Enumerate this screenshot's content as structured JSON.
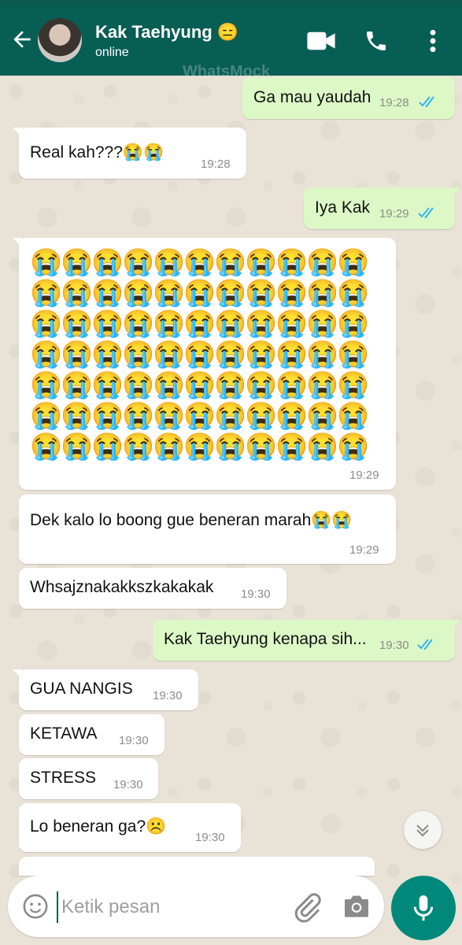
{
  "header": {
    "contact_name": "Kak Taehyung",
    "contact_emoji": "😑",
    "status": "online",
    "watermark": "WhatsMock"
  },
  "messages": [
    {
      "type": "out",
      "text": "Ga mau yaudah",
      "time": "19:28",
      "read": true
    },
    {
      "type": "in",
      "text": "Real kah???😭😭",
      "time": "19:28"
    },
    {
      "type": "out",
      "text": "Iya Kak",
      "time": "19:29",
      "read": true
    },
    {
      "type": "in",
      "emoji_block": "😭",
      "emoji_rows": 7,
      "emoji_cols": 11,
      "time": "19:29"
    },
    {
      "type": "in",
      "text": "Dek kalo lo boong gue beneran marah😭😭",
      "time": "19:29"
    },
    {
      "type": "in",
      "text": "Whsajznakakkszkakakak",
      "time": "19:30"
    },
    {
      "type": "out",
      "text": "Kak Taehyung kenapa sih...",
      "time": "19:30",
      "read": true
    },
    {
      "type": "in",
      "text": "GUA NANGIS",
      "time": "19:30"
    },
    {
      "type": "in",
      "text": "KETAWA",
      "time": "19:30"
    },
    {
      "type": "in",
      "text": "STRESS",
      "time": "19:30"
    },
    {
      "type": "in",
      "text": "Lo beneran ga?☹️",
      "time": "19:30"
    }
  ],
  "input": {
    "placeholder": "Ketik pesan"
  },
  "colors": {
    "header": "#075e54",
    "outgoing_bubble": "#dcf8c6",
    "incoming_bubble": "#ffffff",
    "read_ticks": "#34b7f1",
    "mic_button": "#00897b"
  }
}
